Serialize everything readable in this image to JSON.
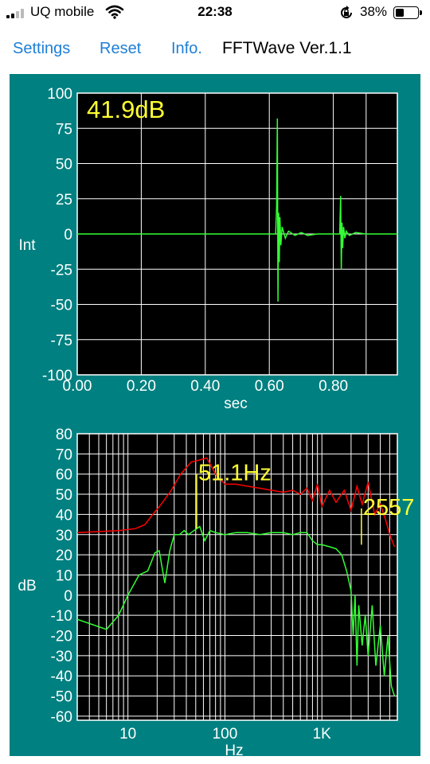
{
  "status_bar": {
    "carrier": "UQ mobile",
    "time": "22:38",
    "battery_percent": "38%",
    "battery_level": 0.38,
    "signal_bars_active": 2,
    "signal_bars_total": 4
  },
  "nav": {
    "settings_label": "Settings",
    "reset_label": "Reset",
    "info_label": "Info.",
    "title": "FFTWave Ver.1.1",
    "link_color": "#1e7fd6"
  },
  "colors": {
    "panel": "#008080",
    "plot_bg": "#000000",
    "grid": "#ffffff",
    "wave": "#33ff33",
    "spectrum_peak": "#ff0000",
    "spectrum_current": "#33ff33",
    "annotation": "#ffff33"
  },
  "chart_data": [
    {
      "type": "line",
      "title": "",
      "level_readout": "41.9dB",
      "xlabel": "sec",
      "ylabel": "Int",
      "xlim": [
        0.0,
        1.0
      ],
      "ylim": [
        -100,
        100
      ],
      "x_ticks": [
        "0.00",
        "0.20",
        "0.40",
        "0.60",
        "0.80"
      ],
      "x_tick_values": [
        0.0,
        0.2,
        0.4,
        0.6,
        0.8
      ],
      "y_ticks": [
        "100",
        "75",
        "50",
        "25",
        "0",
        "-25",
        "-50",
        "-75",
        "-100"
      ],
      "y_tick_values": [
        100,
        75,
        50,
        25,
        0,
        -25,
        -50,
        -75,
        -100
      ],
      "grid": true,
      "series": [
        {
          "x": [
            0.0,
            0.55,
            0.62,
            0.623,
            0.625,
            0.627,
            0.629,
            0.631,
            0.633,
            0.636,
            0.64,
            0.65,
            0.66,
            0.68,
            0.7,
            0.72,
            0.75,
            0.8,
            0.82,
            0.823,
            0.825,
            0.827,
            0.829,
            0.832,
            0.836,
            0.84,
            0.85,
            0.87,
            0.9,
            1.0
          ],
          "y": [
            0,
            0,
            0,
            20,
            82,
            -48,
            15,
            -20,
            12,
            -8,
            5,
            -3,
            2,
            -1,
            1,
            -1,
            0,
            0,
            0,
            27,
            -25,
            8,
            -10,
            5,
            -3,
            2,
            -1,
            1,
            0,
            0
          ]
        }
      ]
    },
    {
      "type": "line",
      "title": "",
      "xlabel": "Hz",
      "ylabel": "dB",
      "x_scale": "log",
      "xlim": [
        3,
        6000
      ],
      "ylim": [
        -62,
        80
      ],
      "x_ticks": [
        "10",
        "100",
        "1K"
      ],
      "x_tick_values": [
        10,
        100,
        1000
      ],
      "y_ticks": [
        "80",
        "70",
        "60",
        "50",
        "40",
        "30",
        "20",
        "10",
        "0",
        "-10",
        "-20",
        "-30",
        "-40",
        "-50",
        "-60"
      ],
      "y_tick_values": [
        80,
        70,
        60,
        50,
        40,
        30,
        20,
        10,
        0,
        -10,
        -20,
        -30,
        -40,
        -50,
        -60
      ],
      "grid": true,
      "annotations": [
        {
          "text": "51.1Hz",
          "freq": 51.1
        },
        {
          "text": "2557",
          "freq": 2557
        }
      ],
      "series": [
        {
          "role": "peak",
          "x": [
            3,
            8,
            12,
            15,
            18,
            22,
            28,
            35,
            45,
            55,
            65,
            80,
            100,
            130,
            170,
            230,
            300,
            400,
            500,
            600,
            700,
            800,
            900,
            1000,
            1200,
            1400,
            1700,
            2000,
            2300,
            2600,
            3000,
            3500,
            4000,
            4500,
            5000,
            5600
          ],
          "y": [
            31,
            32,
            33,
            35,
            40,
            45,
            52,
            60,
            66,
            67,
            68,
            60,
            55,
            55,
            54,
            53,
            52,
            51,
            52,
            50,
            53,
            47,
            55,
            44,
            52,
            46,
            52,
            42,
            54,
            45,
            56,
            40,
            45,
            38,
            30,
            24
          ]
        },
        {
          "role": "current",
          "x": [
            3,
            6,
            8,
            10,
            13,
            16,
            19,
            21,
            24,
            27,
            30,
            34,
            38,
            42,
            48,
            55,
            62,
            70,
            80,
            100,
            130,
            170,
            230,
            300,
            400,
            500,
            600,
            700,
            800,
            900,
            1000,
            1200,
            1400,
            1600,
            1800,
            2000,
            2100,
            2200,
            2300,
            2400,
            2600,
            2800,
            3000,
            3300,
            3600,
            4000,
            4400,
            4800,
            5200,
            5600
          ],
          "y": [
            -12,
            -17,
            -10,
            0,
            10,
            12,
            21,
            22,
            6,
            22,
            30,
            30,
            32,
            30,
            32,
            34,
            27,
            32,
            31,
            30,
            31,
            31,
            30,
            31,
            31,
            30,
            31,
            31,
            27,
            25,
            25,
            24,
            23,
            20,
            12,
            2,
            -20,
            0,
            -35,
            -5,
            -25,
            -10,
            -30,
            -5,
            -35,
            -15,
            -40,
            -20,
            -45,
            -50
          ]
        }
      ]
    }
  ]
}
